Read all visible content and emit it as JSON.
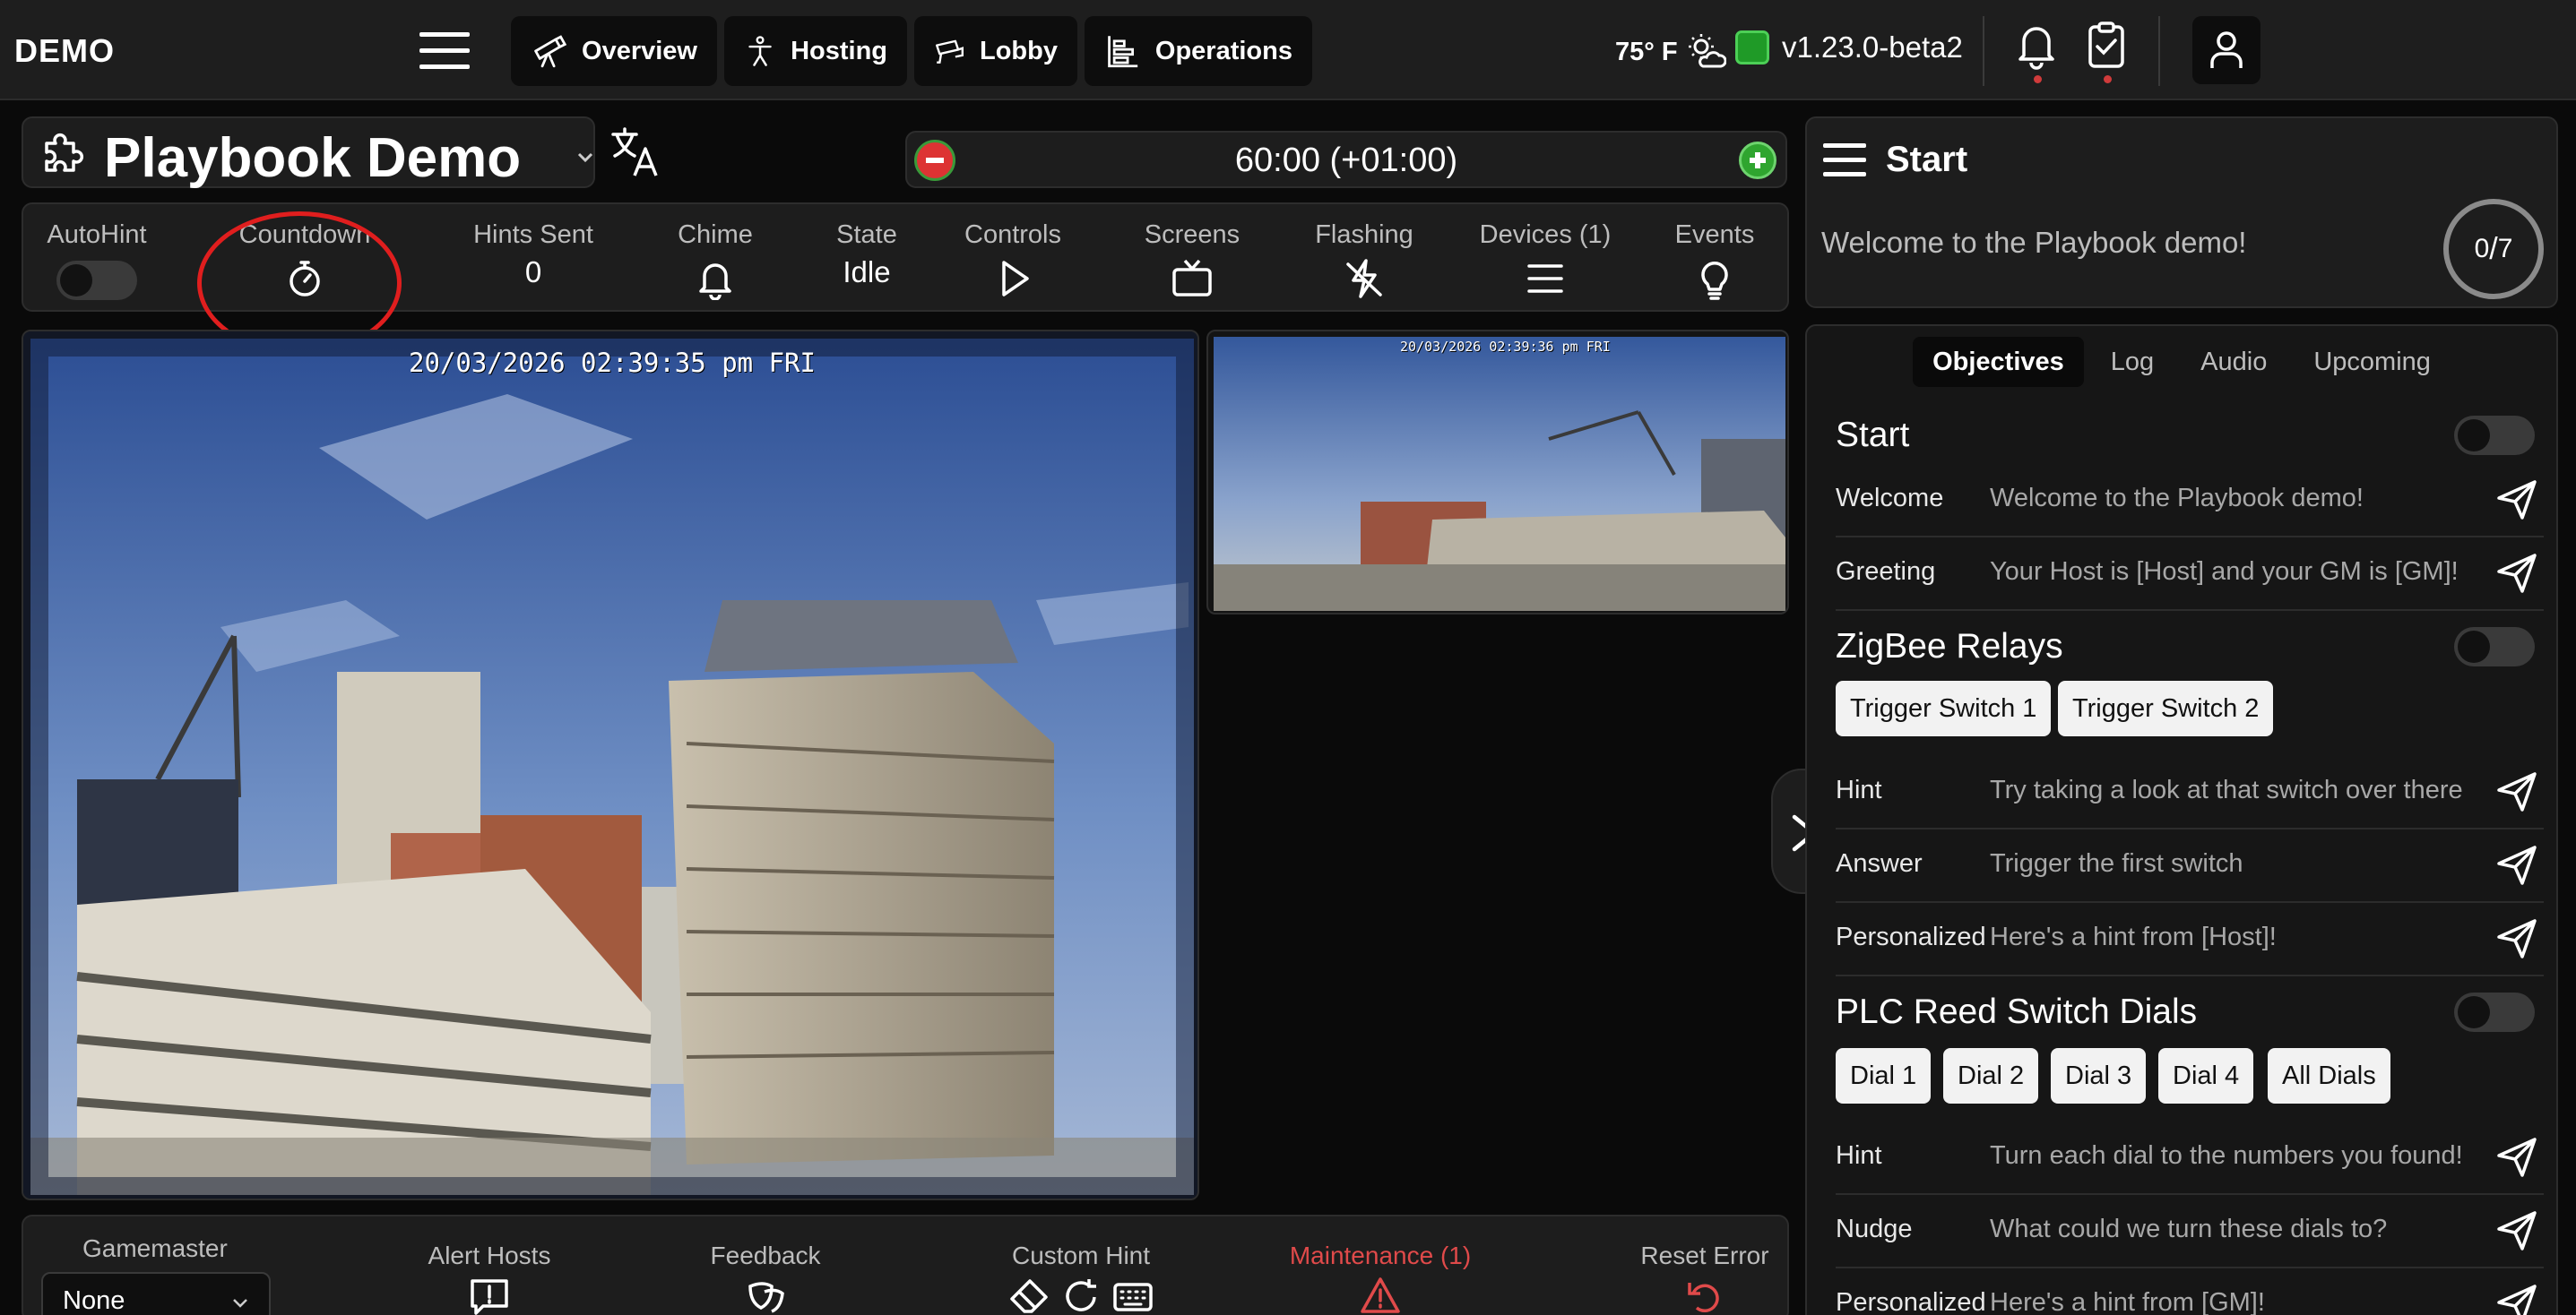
{
  "app": {
    "brand": "DEMO"
  },
  "nav": {
    "overview": "Overview",
    "hosting": "Hosting",
    "lobby": "Lobby",
    "operations": "Operations"
  },
  "status": {
    "weather": "75° F",
    "version": "v1.23.0-beta2"
  },
  "game": {
    "title": "Playbook Demo"
  },
  "timer": {
    "display": "60:00 (+01:00)"
  },
  "controls": {
    "autohint": "AutoHint",
    "countdown": "Countdown",
    "hints_sent_label": "Hints Sent",
    "hints_sent_value": "0",
    "chime": "Chime",
    "state_label": "State",
    "state_value": "Idle",
    "controls": "Controls",
    "screens": "Screens",
    "flashing": "Flashing",
    "devices": "Devices (1)",
    "events": "Events"
  },
  "cameras": {
    "main_timestamp": "20/03/2026 02:39:35 pm FRI",
    "side_timestamp": "20/03/2026 02:39:36 pm FRI"
  },
  "bottom": {
    "gamemaster_label": "Gamemaster",
    "gamemaster_value": "None",
    "alert_hosts": "Alert Hosts",
    "feedback": "Feedback",
    "custom_hint": "Custom Hint",
    "maintenance": "Maintenance (1)",
    "reset_error": "Reset Error"
  },
  "panel": {
    "title": "Start",
    "welcome": "Welcome to the Playbook demo!",
    "progress_done": "0",
    "progress_total": "7",
    "tabs": [
      "Objectives",
      "Log",
      "Audio",
      "Upcoming"
    ],
    "sections": [
      {
        "title": "Start",
        "rows": [
          {
            "label": "Welcome",
            "msg": "Welcome to the Playbook demo!"
          },
          {
            "label": "Greeting",
            "msg": "Your Host is [Host] and your GM is [GM]!"
          }
        ]
      },
      {
        "title": "ZigBee Relays",
        "chips": [
          "Trigger Switch 1",
          "Trigger Switch 2"
        ],
        "rows": [
          {
            "label": "Hint",
            "msg": "Try taking a look at that switch over there"
          },
          {
            "label": "Answer",
            "msg": "Trigger the first switch"
          },
          {
            "label": "Personalized",
            "msg": "Here's a hint from [Host]!"
          }
        ]
      },
      {
        "title": "PLC Reed Switch Dials",
        "chips": [
          "Dial 1",
          "Dial 2",
          "Dial 3",
          "Dial 4",
          "All Dials"
        ],
        "rows": [
          {
            "label": "Hint",
            "msg": "Turn each dial to the numbers you found!"
          },
          {
            "label": "Nudge",
            "msg": "What could we turn these dials to?"
          },
          {
            "label": "Personalized",
            "msg": "Here's a hint from [GM]!"
          }
        ]
      }
    ]
  },
  "colors": {
    "background": "#0a0a0a",
    "panel": "#1d1d1d",
    "status_green": "#1f9a27",
    "danger": "#dd3333",
    "maintenance": "#e04a4a",
    "annotation_red": "#e01e1e"
  },
  "icons": {
    "nav_overview": "telescope-icon",
    "nav_hosting": "person-icon",
    "nav_lobby": "cctv-icon",
    "nav_operations": "chart-icon",
    "weather": "sun-cloud-icon",
    "notifications": "bell-icon",
    "tasks": "clipboard-check-icon",
    "user": "user-icon"
  }
}
